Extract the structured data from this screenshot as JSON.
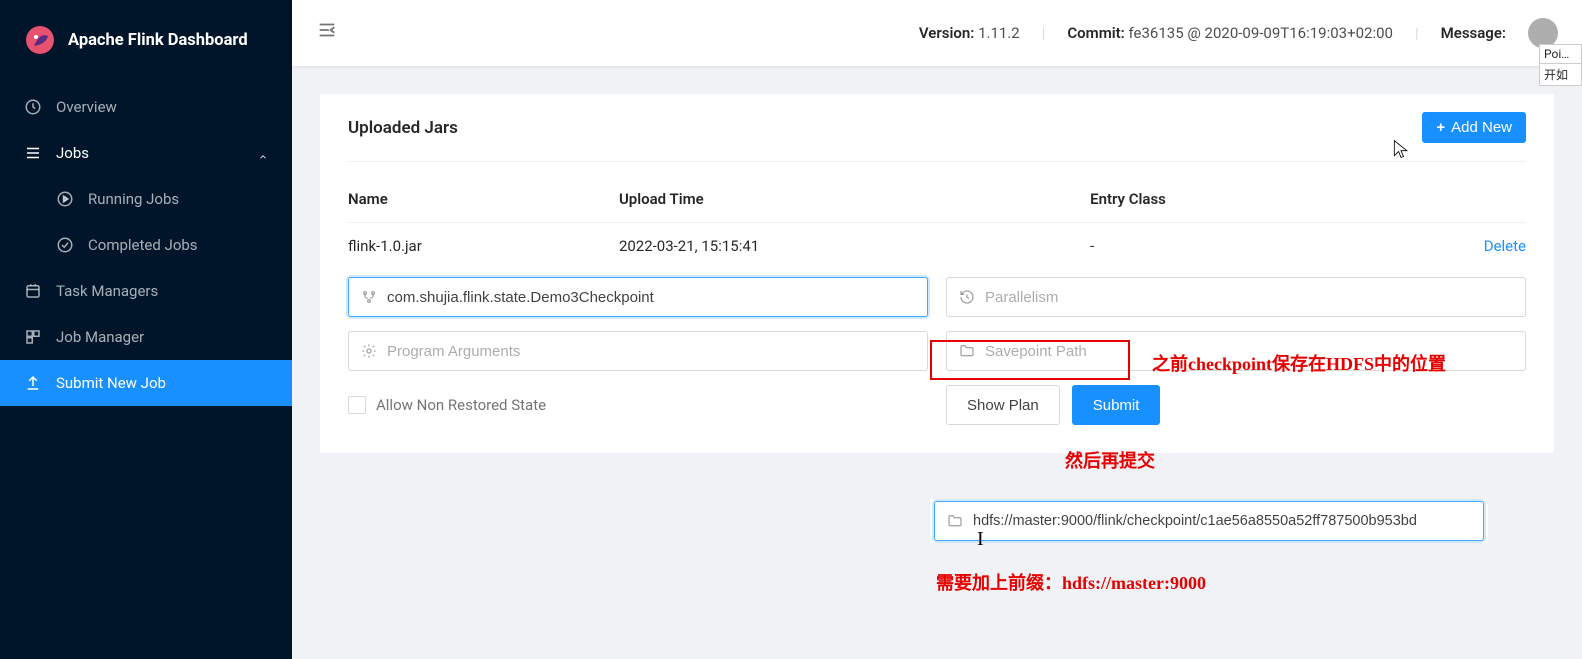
{
  "brand": "Apache Flink Dashboard",
  "menu": {
    "overview": "Overview",
    "jobs": "Jobs",
    "running_jobs": "Running Jobs",
    "completed_jobs": "Completed Jobs",
    "task_managers": "Task Managers",
    "job_manager": "Job Manager",
    "submit_new_job": "Submit New Job"
  },
  "header": {
    "version_label": "Version:",
    "version": "1.11.2",
    "commit_label": "Commit:",
    "commit": "fe36135 @ 2020-09-09T16:19:03+02:00",
    "message_label": "Message:",
    "tooltip_line1": "Poi…",
    "tooltip_line2": "开如"
  },
  "card": {
    "title": "Uploaded Jars",
    "add_new": "Add New",
    "columns": {
      "name": "Name",
      "upload_time": "Upload Time",
      "entry_class": "Entry Class"
    },
    "row": {
      "name": "flink-1.0.jar",
      "upload_time": "2022-03-21, 15:15:41",
      "entry_class": "-",
      "action": "Delete"
    },
    "inputs": {
      "entry_class_value": "com.shujia.flink.state.Demo3Checkpoint",
      "parallelism_placeholder": "Parallelism",
      "program_args_placeholder": "Program Arguments",
      "savepoint_placeholder": "Savepoint Path"
    },
    "checkbox_label": "Allow Non Restored State",
    "show_plan": "Show Plan",
    "submit": "Submit"
  },
  "annotations": {
    "savepoint_hint": "之前checkpoint保存在HDFS中的位置",
    "submit_hint": "然后再提交",
    "prefix_hint": "需要加上前缀：hdfs://master:9000"
  },
  "example_input_value": "hdfs://master:9000/flink/checkpoint/c1ae56a8550a52ff787500b953bd"
}
